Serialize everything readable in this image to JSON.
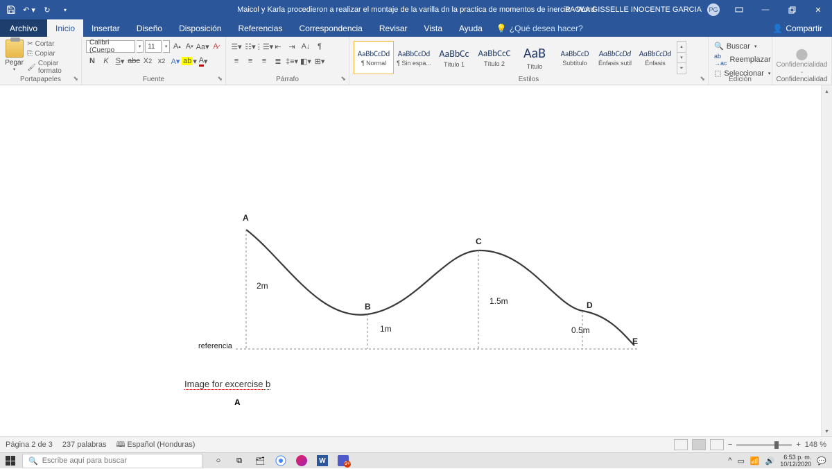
{
  "titlebar": {
    "title": "Maicol y Karla procedieron a realizar el montaje de la varilla dn la practica de momentos de inercia  -  Word",
    "user": "PAOLA GISSELLE INOCENTE GARCIA",
    "badge": "PG"
  },
  "tabs": {
    "file": "Archivo",
    "items": [
      "Inicio",
      "Insertar",
      "Diseño",
      "Disposición",
      "Referencias",
      "Correspondencia",
      "Revisar",
      "Vista",
      "Ayuda"
    ],
    "tellme": "¿Qué desea hacer?",
    "share": "Compartir"
  },
  "ribbon": {
    "clipboard": {
      "title": "Portapapeles",
      "paste": "Pegar",
      "cut": "Cortar",
      "copy": "Copiar",
      "fmt": "Copiar formato"
    },
    "font": {
      "title": "Fuente",
      "name": "Calibri (Cuerpo",
      "size": "11"
    },
    "paragraph": {
      "title": "Párrafo"
    },
    "styles": {
      "title": "Estilos",
      "items": [
        {
          "prev": "AaBbCcDd",
          "lbl": "¶ Normal",
          "size": "11px"
        },
        {
          "prev": "AaBbCcDd",
          "lbl": "¶ Sin espa...",
          "size": "11px"
        },
        {
          "prev": "AaBbCc",
          "lbl": "Título 1",
          "size": "14px"
        },
        {
          "prev": "AaBbCcC",
          "lbl": "Título 2",
          "size": "13px"
        },
        {
          "prev": "AaB",
          "lbl": "Título",
          "size": "20px"
        },
        {
          "prev": "AaBbCcD",
          "lbl": "Subtítulo",
          "size": "11px"
        },
        {
          "prev": "AaBbCcDd",
          "lbl": "Énfasis sutil",
          "size": "11px",
          "it": true
        },
        {
          "prev": "AaBbCcDd",
          "lbl": "Énfasis",
          "size": "11px",
          "it": true
        }
      ]
    },
    "editing": {
      "title": "Edición",
      "find": "Buscar",
      "replace": "Reemplazar",
      "select": "Seleccionar"
    },
    "conf": {
      "title": "Confidencialidad",
      "label": "Confidencialidad",
      "sub": "-"
    }
  },
  "figure": {
    "A": "A",
    "B": "B",
    "C": "C",
    "D": "D",
    "E": "E",
    "h2m": "2m",
    "h1m": "1m",
    "h15m": "1.5m",
    "h05m": "0.5m",
    "ref": "referencia",
    "caption_a": "Image for excercise",
    "caption_b": " b",
    "A2": "A"
  },
  "status": {
    "page": "Página 2 de 3",
    "words": "237 palabras",
    "lang": "Español (Honduras)",
    "zoom": "148 %"
  },
  "taskbar": {
    "search": "Escribe aquí para buscar",
    "time": "6:53 p. m.",
    "date": "10/12/2020"
  }
}
